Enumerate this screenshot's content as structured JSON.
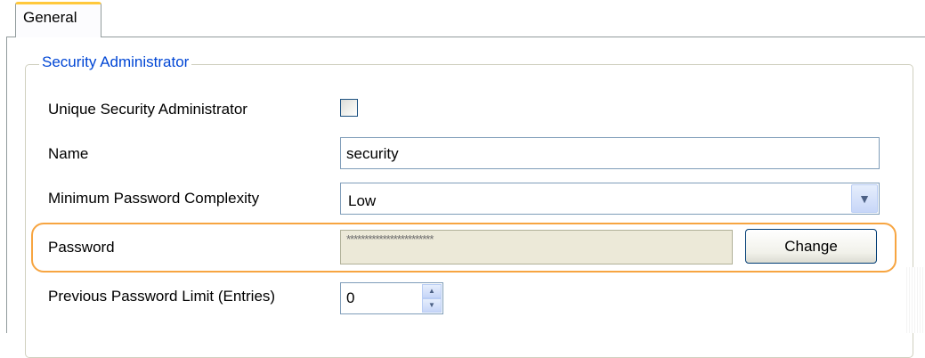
{
  "tabs": [
    {
      "label": "General",
      "active": true
    }
  ],
  "group": {
    "legend": "Security Administrator"
  },
  "fields": {
    "unique_admin": {
      "label": "Unique Security Administrator",
      "checked": false
    },
    "name": {
      "label": "Name",
      "value": "security"
    },
    "complexity": {
      "label": "Minimum Password Complexity",
      "value": "Low"
    },
    "password": {
      "label": "Password",
      "value": "************************",
      "button": "Change"
    },
    "prev_limit": {
      "label": "Previous Password Limit (Entries)",
      "value": "0"
    }
  },
  "icons": {
    "dropdown": "chevron-down-icon",
    "spin_up": "arrow-up-icon",
    "spin_down": "arrow-down-icon"
  },
  "colors": {
    "legend": "#0046d5",
    "highlight": "#f7a541",
    "tab_accent": "#ffc83c",
    "disabled_field": "#ece9d8"
  }
}
